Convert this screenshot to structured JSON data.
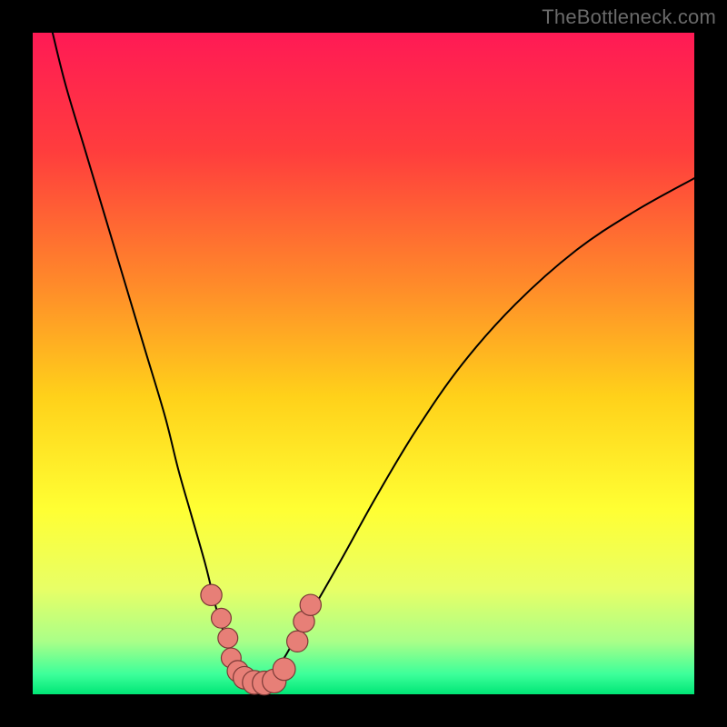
{
  "watermark": "TheBottleneck.com",
  "colors": {
    "frame_bg": "#000000",
    "gradient_stops": [
      {
        "pos": 0.0,
        "color": "#ff1a55"
      },
      {
        "pos": 0.18,
        "color": "#ff3d3d"
      },
      {
        "pos": 0.38,
        "color": "#ff8a2a"
      },
      {
        "pos": 0.55,
        "color": "#ffd11a"
      },
      {
        "pos": 0.72,
        "color": "#ffff33"
      },
      {
        "pos": 0.84,
        "color": "#e8ff66"
      },
      {
        "pos": 0.92,
        "color": "#aaff88"
      },
      {
        "pos": 0.97,
        "color": "#3cff9a"
      },
      {
        "pos": 1.0,
        "color": "#00e676"
      }
    ],
    "curve_stroke": "#000000",
    "marker_fill": "#e77f77",
    "marker_stroke": "#7b3a36"
  },
  "chart_data": {
    "type": "line",
    "title": "",
    "xlabel": "",
    "ylabel": "",
    "xlim": [
      0,
      100
    ],
    "ylim": [
      0,
      100
    ],
    "series": [
      {
        "name": "left-curve",
        "x": [
          3,
          5,
          8,
          11,
          14,
          17,
          20,
          22,
          24,
          26,
          27,
          28,
          29,
          30,
          31,
          32,
          33,
          34
        ],
        "y": [
          100,
          92,
          82,
          72,
          62,
          52,
          42,
          34,
          27,
          20,
          16,
          12,
          9,
          6.5,
          4.5,
          3,
          2,
          1.5
        ]
      },
      {
        "name": "right-curve",
        "x": [
          34,
          36,
          38,
          40,
          43,
          47,
          52,
          58,
          65,
          73,
          82,
          91,
          100
        ],
        "y": [
          1.5,
          3,
          5.5,
          9,
          14,
          21,
          30,
          40,
          50,
          59,
          67,
          73,
          78
        ]
      }
    ],
    "markers": [
      {
        "x": 27.0,
        "y": 15.0,
        "r": 1.6
      },
      {
        "x": 28.5,
        "y": 11.5,
        "r": 1.5
      },
      {
        "x": 29.5,
        "y": 8.5,
        "r": 1.5
      },
      {
        "x": 30.0,
        "y": 5.5,
        "r": 1.5
      },
      {
        "x": 31.0,
        "y": 3.5,
        "r": 1.6
      },
      {
        "x": 32.0,
        "y": 2.5,
        "r": 1.7
      },
      {
        "x": 33.5,
        "y": 1.8,
        "r": 1.8
      },
      {
        "x": 35.0,
        "y": 1.7,
        "r": 1.8
      },
      {
        "x": 36.5,
        "y": 2.0,
        "r": 1.8
      },
      {
        "x": 38.0,
        "y": 3.8,
        "r": 1.7
      },
      {
        "x": 40.0,
        "y": 8.0,
        "r": 1.6
      },
      {
        "x": 41.0,
        "y": 11.0,
        "r": 1.6
      },
      {
        "x": 42.0,
        "y": 13.5,
        "r": 1.6
      }
    ],
    "grid": false,
    "legend": false
  }
}
